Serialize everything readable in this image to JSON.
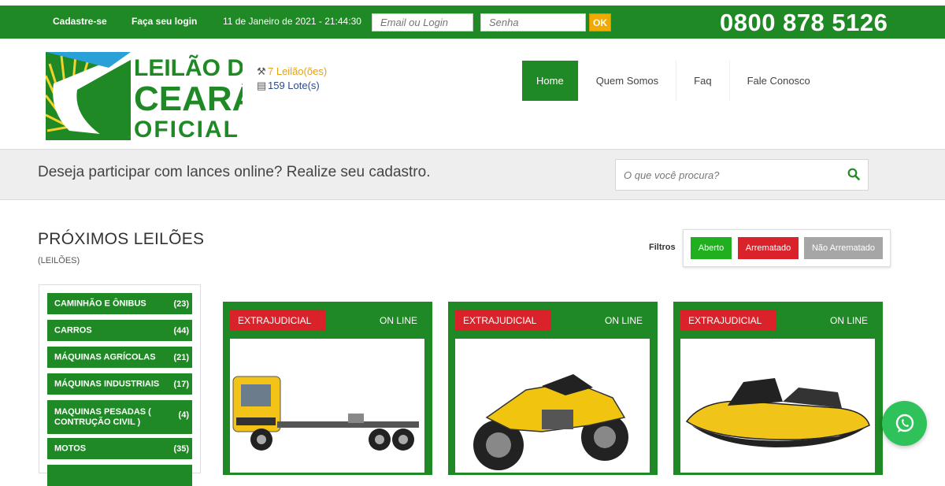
{
  "topbar": {
    "signup": "Cadastre-se",
    "login": "Faça seu login",
    "datetime": "11 de Janeiro de 2021 - 21:44:30",
    "email_placeholder": "Email ou Login",
    "password_placeholder": "Senha",
    "ok": "OK",
    "phone": "0800 878 5126"
  },
  "header": {
    "logo_text": [
      "LEILÃO DO",
      "CEARÁ",
      "OFICIAL"
    ],
    "auctions": "7 Leilão(ões)",
    "lots": "159 Lote(s)"
  },
  "nav": [
    "Home",
    "Quem Somos",
    "Faq",
    "Fale Conosco"
  ],
  "banner": {
    "text": "Deseja participar com lances online? Realize seu cadastro.",
    "search_placeholder": "O que você procura?"
  },
  "section": {
    "title": "PRÓXIMOS LEILÕES",
    "subtitle": "(LEILÕES)",
    "filters_label": "Filtros",
    "filters": [
      "Aberto",
      "Arrematado",
      "Não Arrematado"
    ]
  },
  "categories": [
    {
      "name": "CAMINHÃO E ÔNIBUS",
      "count": "(23)"
    },
    {
      "name": "CARROS",
      "count": "(44)"
    },
    {
      "name": "MÁQUINAS AGRÍCOLAS",
      "count": "(21)"
    },
    {
      "name": "MÁQUINAS INDUSTRIAIS",
      "count": "(17)"
    },
    {
      "name": "MAQUINAS PESADAS ( CONTRUÇÃO CIVIL )",
      "count": "(4)"
    },
    {
      "name": "MOTOS",
      "count": "(35)"
    }
  ],
  "cards": [
    {
      "tag": "EXTRAJUDICIAL",
      "status": "ON LINE",
      "image": "truck"
    },
    {
      "tag": "EXTRAJUDICIAL",
      "status": "ON LINE",
      "image": "motorcycle"
    },
    {
      "tag": "EXTRAJUDICIAL",
      "status": "ON LINE",
      "image": "jet-ski"
    }
  ],
  "colors": {
    "brand_green": "#1f8a25",
    "tag_red": "#d9222a",
    "accent_yellow": "#f2a900",
    "filter_open": "#1faf1f",
    "filter_sold": "#d9222a",
    "filter_unsold": "#a6a6a6",
    "whatsapp": "#2fc15a"
  }
}
